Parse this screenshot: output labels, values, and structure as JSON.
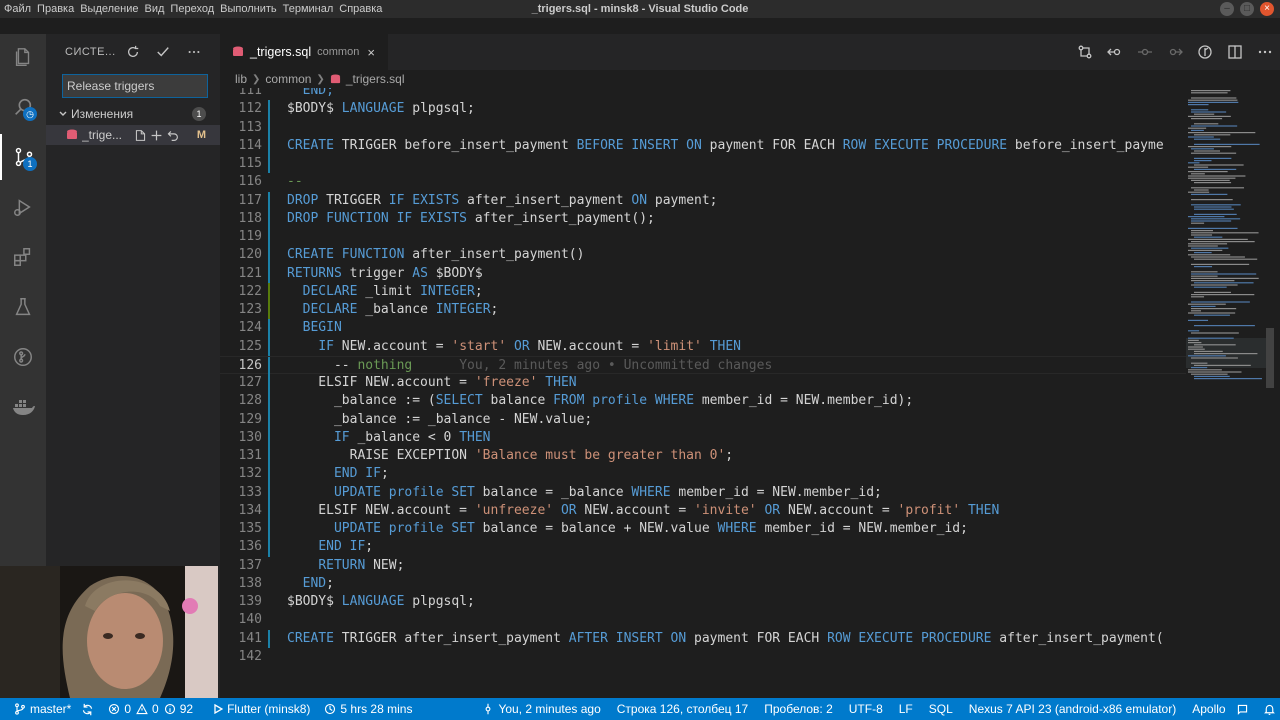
{
  "window": {
    "title": "_trigers.sql - minsk8 - Visual Studio Code"
  },
  "menu": [
    "Файл",
    "Правка",
    "Выделение",
    "Вид",
    "Переход",
    "Выполнить",
    "Терминал",
    "Справка"
  ],
  "activity": {
    "scm_badge": "1"
  },
  "scm": {
    "title": "СИСТЕ...",
    "commit_message": "Release triggers",
    "changes_label": "Изменения",
    "changes_count": "1",
    "file_name": "_trige...",
    "file_status": "M"
  },
  "tab": {
    "name": "_trigers.sql",
    "description": "common",
    "close": "×"
  },
  "breadcrumbs": {
    "parts": [
      "lib",
      "common",
      "_trigers.sql"
    ]
  },
  "code": {
    "line_numbers": [
      "111",
      "112",
      "113",
      "114",
      "115",
      "116",
      "117",
      "118",
      "119",
      "120",
      "121",
      "122",
      "123",
      "124",
      "125",
      "126",
      "127",
      "128",
      "129",
      "130",
      "131",
      "132",
      "133",
      "134",
      "135",
      "136",
      "137",
      "138",
      "139",
      "140",
      "141",
      "142"
    ],
    "lines": [
      [
        {
          "t": "  END;",
          "c": "kw"
        }
      ],
      [
        {
          "t": "$BODY$ "
        },
        {
          "t": "LANGUAGE",
          "c": "kw"
        },
        {
          "t": " plpgsql;"
        }
      ],
      [],
      [
        {
          "t": "CREATE",
          "c": "kw"
        },
        {
          "t": " TRIGGER before_insert_payment "
        },
        {
          "t": "BEFORE INSERT ON",
          "c": "kw"
        },
        {
          "t": " payment FOR EACH "
        },
        {
          "t": "ROW EXECUTE PROCEDURE",
          "c": "kw"
        },
        {
          "t": " before_insert_payme"
        }
      ],
      [],
      [
        {
          "t": "--",
          "c": "cm"
        }
      ],
      [
        {
          "t": "DROP",
          "c": "kw"
        },
        {
          "t": " TRIGGER "
        },
        {
          "t": "IF EXISTS",
          "c": "kw"
        },
        {
          "t": " after_insert_payment "
        },
        {
          "t": "ON",
          "c": "kw"
        },
        {
          "t": " payment;"
        }
      ],
      [
        {
          "t": "DROP FUNCTION IF EXISTS",
          "c": "kw"
        },
        {
          "t": " after_insert_payment();"
        }
      ],
      [],
      [
        {
          "t": "CREATE FUNCTION",
          "c": "kw"
        },
        {
          "t": " after_insert_payment()"
        }
      ],
      [
        {
          "t": "RETURNS",
          "c": "kw"
        },
        {
          "t": " trigger "
        },
        {
          "t": "AS",
          "c": "kw"
        },
        {
          "t": " $BODY$"
        }
      ],
      [
        {
          "t": "  "
        },
        {
          "t": "DECLARE",
          "c": "kw"
        },
        {
          "t": " _limit "
        },
        {
          "t": "INTEGER",
          "c": "kw"
        },
        {
          "t": ";"
        }
      ],
      [
        {
          "t": "  "
        },
        {
          "t": "DECLARE",
          "c": "kw"
        },
        {
          "t": " _balance "
        },
        {
          "t": "INTEGER",
          "c": "kw"
        },
        {
          "t": ";"
        }
      ],
      [
        {
          "t": "  "
        },
        {
          "t": "BEGIN",
          "c": "kw"
        }
      ],
      [
        {
          "t": "    "
        },
        {
          "t": "IF",
          "c": "kw"
        },
        {
          "t": " NEW.account = "
        },
        {
          "t": "'start'",
          "c": "str"
        },
        {
          "t": " "
        },
        {
          "t": "OR",
          "c": "kw"
        },
        {
          "t": " NEW.account = "
        },
        {
          "t": "'limit'",
          "c": "str"
        },
        {
          "t": " "
        },
        {
          "t": "THEN",
          "c": "kw"
        }
      ],
      [
        {
          "t": "      -- "
        },
        {
          "t": "nothing",
          "c": "cm"
        },
        {
          "t": "      You, 2 minutes ago • Uncommitted changes",
          "c": "blame"
        }
      ],
      [
        {
          "t": "    ELSIF NEW.account = "
        },
        {
          "t": "'freeze'",
          "c": "str"
        },
        {
          "t": " "
        },
        {
          "t": "THEN",
          "c": "kw"
        }
      ],
      [
        {
          "t": "      _balance := ("
        },
        {
          "t": "SELECT",
          "c": "kw"
        },
        {
          "t": " balance "
        },
        {
          "t": "FROM profile WHERE",
          "c": "kw"
        },
        {
          "t": " member_id = NEW.member_id);"
        }
      ],
      [
        {
          "t": "      _balance := _balance - NEW.value;"
        }
      ],
      [
        {
          "t": "      "
        },
        {
          "t": "IF",
          "c": "kw"
        },
        {
          "t": " _balance < 0 "
        },
        {
          "t": "THEN",
          "c": "kw"
        }
      ],
      [
        {
          "t": "        RAISE EXCEPTION "
        },
        {
          "t": "'Balance must be greater than 0'",
          "c": "str"
        },
        {
          "t": ";"
        }
      ],
      [
        {
          "t": "      "
        },
        {
          "t": "END IF",
          "c": "kw"
        },
        {
          "t": ";"
        }
      ],
      [
        {
          "t": "      "
        },
        {
          "t": "UPDATE profile SET",
          "c": "kw"
        },
        {
          "t": " balance = _balance "
        },
        {
          "t": "WHERE",
          "c": "kw"
        },
        {
          "t": " member_id = NEW.member_id;"
        }
      ],
      [
        {
          "t": "    ELSIF NEW.account = "
        },
        {
          "t": "'unfreeze'",
          "c": "str"
        },
        {
          "t": " "
        },
        {
          "t": "OR",
          "c": "kw"
        },
        {
          "t": " NEW.account = "
        },
        {
          "t": "'invite'",
          "c": "str"
        },
        {
          "t": " "
        },
        {
          "t": "OR",
          "c": "kw"
        },
        {
          "t": " NEW.account = "
        },
        {
          "t": "'profit'",
          "c": "str"
        },
        {
          "t": " "
        },
        {
          "t": "THEN",
          "c": "kw"
        }
      ],
      [
        {
          "t": "      "
        },
        {
          "t": "UPDATE profile SET",
          "c": "kw"
        },
        {
          "t": " balance = balance + NEW.value "
        },
        {
          "t": "WHERE",
          "c": "kw"
        },
        {
          "t": " member_id = NEW.member_id;"
        }
      ],
      [
        {
          "t": "    "
        },
        {
          "t": "END IF",
          "c": "kw"
        },
        {
          "t": ";"
        }
      ],
      [
        {
          "t": "    "
        },
        {
          "t": "RETURN",
          "c": "kw"
        },
        {
          "t": " NEW;"
        }
      ],
      [
        {
          "t": "  "
        },
        {
          "t": "END",
          "c": "kw"
        },
        {
          "t": ";"
        }
      ],
      [
        {
          "t": "$BODY$ "
        },
        {
          "t": "LANGUAGE",
          "c": "kw"
        },
        {
          "t": " plpgsql;"
        }
      ],
      [],
      [
        {
          "t": "CREATE",
          "c": "kw"
        },
        {
          "t": " TRIGGER after_insert_payment "
        },
        {
          "t": "AFTER INSERT ON",
          "c": "kw"
        },
        {
          "t": " payment FOR EACH "
        },
        {
          "t": "ROW EXECUTE PROCEDURE",
          "c": "kw"
        },
        {
          "t": " after_insert_payment("
        }
      ],
      []
    ],
    "gutter": [
      "none",
      "mod",
      "mod",
      "mod",
      "mod",
      "none",
      "mod",
      "mod",
      "mod",
      "mod",
      "mod",
      "add",
      "add",
      "mod",
      "mod",
      "mod",
      "mod",
      "mod",
      "mod",
      "mod",
      "mod",
      "mod",
      "mod",
      "mod",
      "mod",
      "mod",
      "none",
      "none",
      "none",
      "none",
      "mod",
      "none"
    ]
  },
  "status": {
    "branch": "master*",
    "errors": "0",
    "warnings": "0",
    "info": "92",
    "flutter": "Flutter (minsk8)",
    "time": "5 hrs 28 mins",
    "blame": "You, 2 minutes ago",
    "position": "Строка 126, столбец 17",
    "spaces": "Пробелов: 2",
    "encoding": "UTF-8",
    "eol": "LF",
    "language": "SQL",
    "device": "Nexus 7 API 23 (android-x86 emulator)",
    "apollo": "Apollo"
  },
  "colors": {
    "accent": "#007acc",
    "modified": "#1b81a8",
    "added": "#587c0c",
    "keyword": "#569cd6",
    "string": "#ce9178"
  }
}
